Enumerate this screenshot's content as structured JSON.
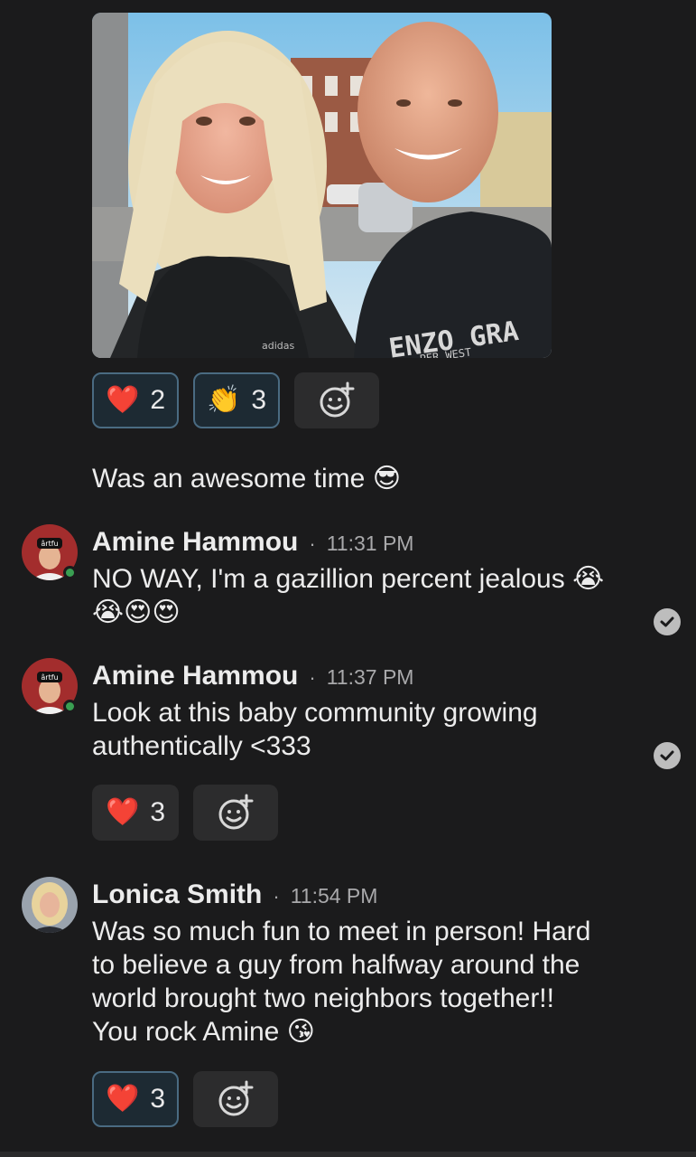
{
  "post_photo": {
    "shirt_text": "ENZO GRA",
    "shirt_subtext": "PER WEST",
    "brand_logo": "adidas"
  },
  "post_reactions": [
    {
      "emoji": "❤️",
      "count": "2",
      "icon": "heart-icon"
    },
    {
      "emoji": "👏",
      "count": "3",
      "icon": "clap-icon"
    }
  ],
  "post_caption": {
    "text": "Was an awesome time",
    "emoji": "😎"
  },
  "messages": [
    {
      "author": "Amine Hammou",
      "time": "11:31 PM",
      "line1": "NO WAY, I'm a gazillion percent jealous 😭",
      "line2": "😭😍😍",
      "avatar_text": "ârtfu"
    },
    {
      "author": "Amine Hammou",
      "time": "11:37 PM",
      "line1": "Look at this baby community growing",
      "line2": "authentically <333",
      "avatar_text": "ârtfu",
      "reaction": {
        "emoji": "❤️",
        "count": "3"
      }
    },
    {
      "author": "Lonica Smith",
      "time": "11:54 PM",
      "line1": "Was so much fun to meet in person!  Hard",
      "line2": "to believe a guy from halfway around the",
      "line3": "world brought two neighbors together!!",
      "line4": "You rock Amine 😘",
      "reaction": {
        "emoji": "❤️",
        "count": "3"
      }
    }
  ],
  "separator": "·",
  "colors": {
    "background": "#1b1b1c",
    "active_reaction_border": "#4a6b82",
    "online": "#3a9f52"
  }
}
